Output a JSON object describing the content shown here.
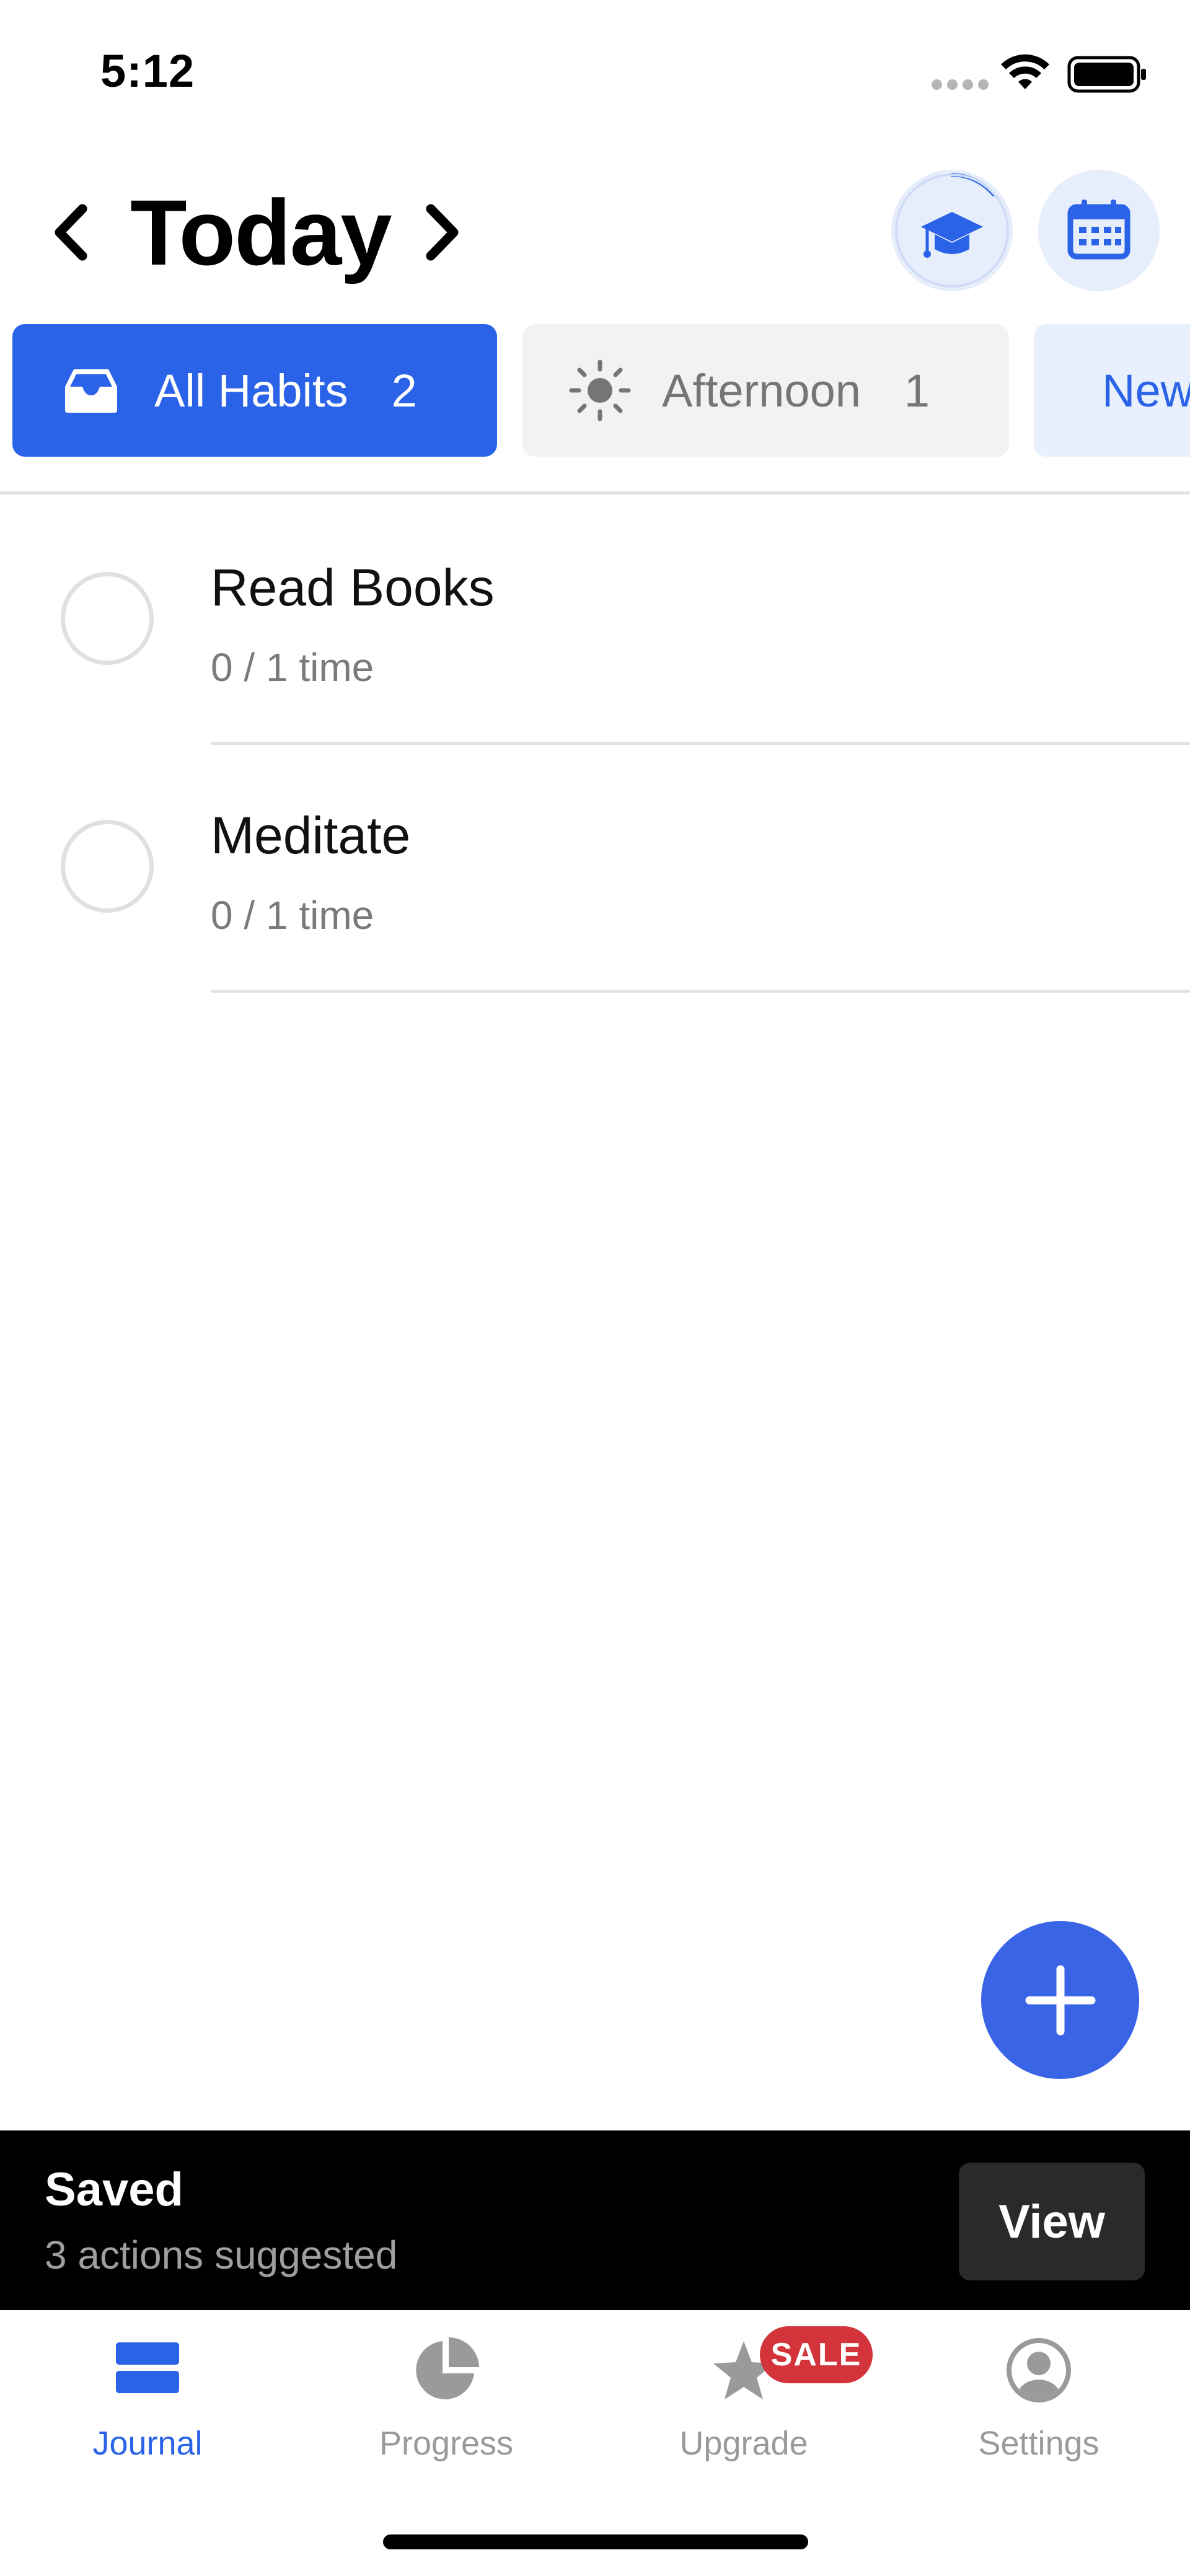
{
  "status_bar": {
    "time": "5:12"
  },
  "header": {
    "title": "Today"
  },
  "filters": [
    {
      "label": "All Habits",
      "count": "2"
    },
    {
      "label": "Afternoon",
      "count": "1"
    },
    {
      "label": "New Area"
    }
  ],
  "habits": [
    {
      "name": "Read Books",
      "progress": "0 / 1 time"
    },
    {
      "name": "Meditate",
      "progress": "0 / 1 time"
    }
  ],
  "snackbar": {
    "title": "Saved",
    "subtitle": "3 actions suggested",
    "action": "View"
  },
  "tab_bar": {
    "items": [
      {
        "label": "Journal",
        "icon": "journal-icon",
        "active": true
      },
      {
        "label": "Progress",
        "icon": "pie-chart-icon"
      },
      {
        "label": "Upgrade",
        "icon": "star-icon",
        "badge": "SALE"
      },
      {
        "label": "Settings",
        "icon": "profile-icon"
      }
    ]
  },
  "colors": {
    "accent": "#2b63e8",
    "fab": "#3a64e6",
    "sale_badge": "#d3343b"
  }
}
